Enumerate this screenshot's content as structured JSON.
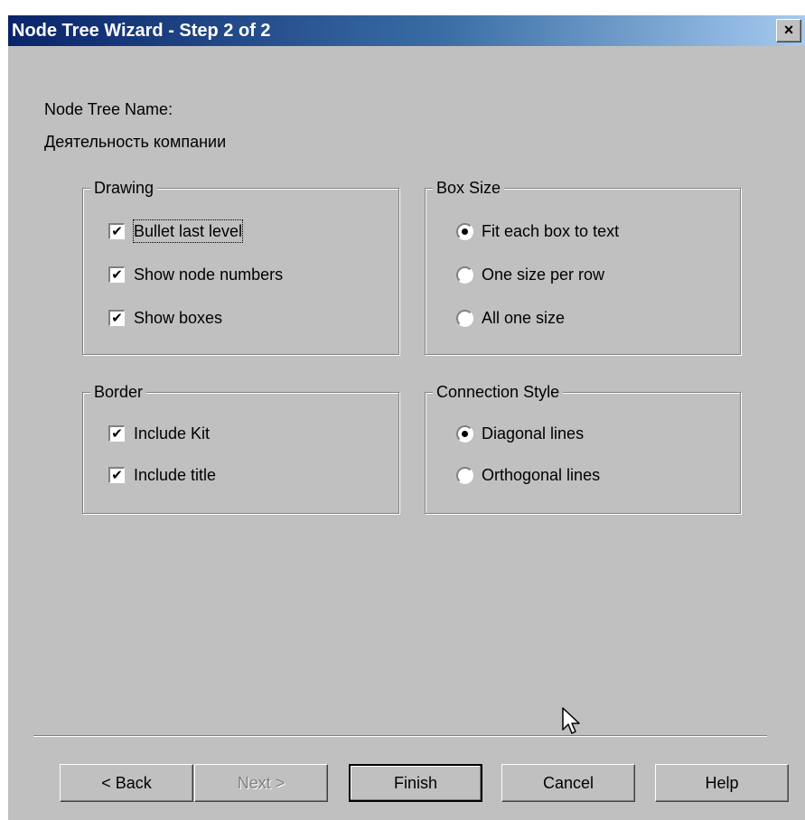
{
  "window": {
    "title": "Node Tree Wizard - Step 2 of 2",
    "close_glyph": "×"
  },
  "node_tree": {
    "label": "Node Tree Name:",
    "value": "Деятельность компании"
  },
  "drawing": {
    "legend": "Drawing",
    "items": [
      {
        "label": "Bullet last level",
        "checked": true
      },
      {
        "label": "Show node numbers",
        "checked": true
      },
      {
        "label": "Show boxes",
        "checked": true
      }
    ]
  },
  "box_size": {
    "legend": "Box Size",
    "items": [
      {
        "label": "Fit each box to text",
        "selected": true
      },
      {
        "label": "One size per row",
        "selected": false
      },
      {
        "label": "All one size",
        "selected": false
      }
    ]
  },
  "border": {
    "legend": "Border",
    "items": [
      {
        "label": "Include Kit",
        "checked": true
      },
      {
        "label": "Include title",
        "checked": true
      }
    ]
  },
  "connection_style": {
    "legend": "Connection Style",
    "items": [
      {
        "label": "Diagonal lines",
        "selected": true
      },
      {
        "label": "Orthogonal lines",
        "selected": false
      }
    ]
  },
  "buttons": {
    "back": "< Back",
    "next": "Next >",
    "finish": "Finish",
    "cancel": "Cancel",
    "help": "Help"
  },
  "checkmark_glyph": "✔",
  "colors": {
    "title_start": "#0a246a",
    "title_end": "#a6caf0",
    "face": "#c0c0c0"
  }
}
